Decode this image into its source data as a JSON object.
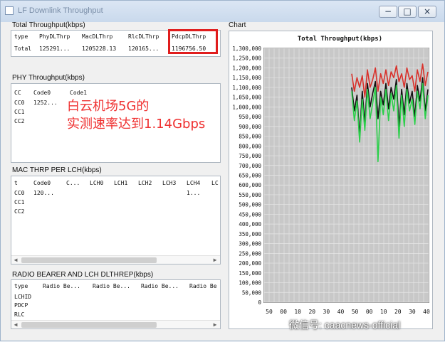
{
  "window": {
    "title": "LF Downlink Throughput",
    "controls": {
      "minimize": "−",
      "maximize": "□",
      "close": "×"
    }
  },
  "total": {
    "title": "Total Throughput(kbps)",
    "headers": [
      "type",
      "PhyDLThrp",
      "MacDLThrp",
      "RlcDLThrp",
      "PdcpDLThrp"
    ],
    "row": [
      "Total",
      "125291...",
      "1205228.13",
      "120165...",
      "1196756.50"
    ]
  },
  "phy": {
    "title": "PHY Throughput(kbps)",
    "headers": [
      "CC",
      "Code0",
      "Code1"
    ],
    "rows": [
      [
        "CC0",
        "1252..."
      ],
      [
        "CC1"
      ],
      [
        "CC2"
      ]
    ]
  },
  "overlay": {
    "line1": "白云机场5G的",
    "line2": "实测速率达到1.14Gbps"
  },
  "mac": {
    "title": "MAC THRP PER LCH(kbps)",
    "headers": [
      "t",
      "Code0",
      "C...",
      "LCH0",
      "LCH1",
      "LCH2",
      "LCH3",
      "LCH4",
      "LC"
    ],
    "rows": [
      [
        "CC0",
        "120...",
        "1..."
      ],
      [
        "CC1"
      ],
      [
        "CC2"
      ]
    ]
  },
  "radio": {
    "title": "RADIO BEARER  AND LCH DLTHREP(kbps)",
    "headers": [
      "type",
      "Radio Be...",
      "Radio Be...",
      "Radio Be...",
      "Radio Be"
    ],
    "rows": [
      "LCHID",
      "PDCP",
      "RLC"
    ]
  },
  "chart": {
    "label": "Chart",
    "watermark": "微信号: caacnews-official",
    "icons": {
      "scroll_left": "◀",
      "scroll_right": "▶"
    }
  },
  "chart_data": {
    "type": "line",
    "title": "Total Throughput(kbps)",
    "yticks": [
      "1,300,000",
      "1,250,000",
      "1,200,000",
      "1,150,000",
      "1,100,000",
      "1,050,000",
      "1,000,000",
      "950,000",
      "900,000",
      "850,000",
      "800,000",
      "750,000",
      "700,000",
      "650,000",
      "600,000",
      "550,000",
      "500,000",
      "450,000",
      "400,000",
      "350,000",
      "300,000",
      "250,000",
      "200,000",
      "150,000",
      "100,000",
      "50,000",
      "0"
    ],
    "xticks": [
      "50",
      "00",
      "10",
      "20",
      "30",
      "40",
      "50",
      "00",
      "10",
      "20",
      "30",
      "40"
    ],
    "ylim": [
      0,
      1300000
    ],
    "series": [
      {
        "color": "#d9312b",
        "values": [
          1170000,
          1080000,
          1150000,
          1100000,
          1160000,
          1050000,
          1190000,
          1100000,
          1140000,
          1200000,
          1080000,
          1170000,
          1120000,
          1190000,
          1110000,
          1180000,
          1150000,
          1210000,
          1130000,
          1170000,
          1100000,
          1200000,
          1140000,
          1160000,
          1080000,
          1190000,
          1130000,
          1220000,
          1110000,
          1180000
        ]
      },
      {
        "color": "#111111",
        "values": [
          1100000,
          980000,
          1060000,
          850000,
          1080000,
          920000,
          1120000,
          1000000,
          1070000,
          1130000,
          940000,
          1080000,
          1010000,
          1120000,
          990000,
          1100000,
          1040000,
          1140000,
          900000,
          1090000,
          960000,
          1120000,
          1020000,
          1080000,
          950000,
          1110000,
          1030000,
          1150000,
          980000,
          1090000
        ]
      },
      {
        "color": "#2bd04a",
        "values": [
          1080000,
          930000,
          1030000,
          820000,
          1040000,
          880000,
          1090000,
          940000,
          1020000,
          1100000,
          720000,
          1050000,
          960000,
          1090000,
          930000,
          1070000,
          980000,
          1110000,
          840000,
          1060000,
          900000,
          1090000,
          980000,
          1040000,
          910000,
          1080000,
          990000,
          1120000,
          940000,
          1060000
        ]
      }
    ]
  }
}
